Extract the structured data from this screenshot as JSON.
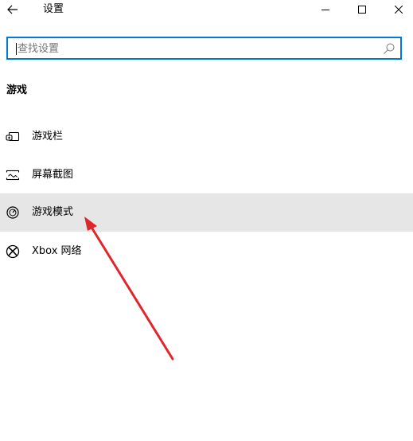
{
  "window": {
    "title": "设置"
  },
  "search": {
    "placeholder": "查找设置",
    "value": ""
  },
  "section": {
    "heading": "游戏"
  },
  "nav": {
    "items": [
      {
        "label": "游戏栏",
        "icon": "game-bar-icon",
        "selected": false
      },
      {
        "label": "屏幕截图",
        "icon": "screenshot-icon",
        "selected": false
      },
      {
        "label": "游戏模式",
        "icon": "game-mode-icon",
        "selected": true
      },
      {
        "label": "Xbox 网络",
        "icon": "xbox-icon",
        "selected": false
      }
    ]
  },
  "colors": {
    "accent": "#0078d7",
    "selected_bg": "#e6e6e6",
    "annotation_arrow": "#e0262b"
  }
}
